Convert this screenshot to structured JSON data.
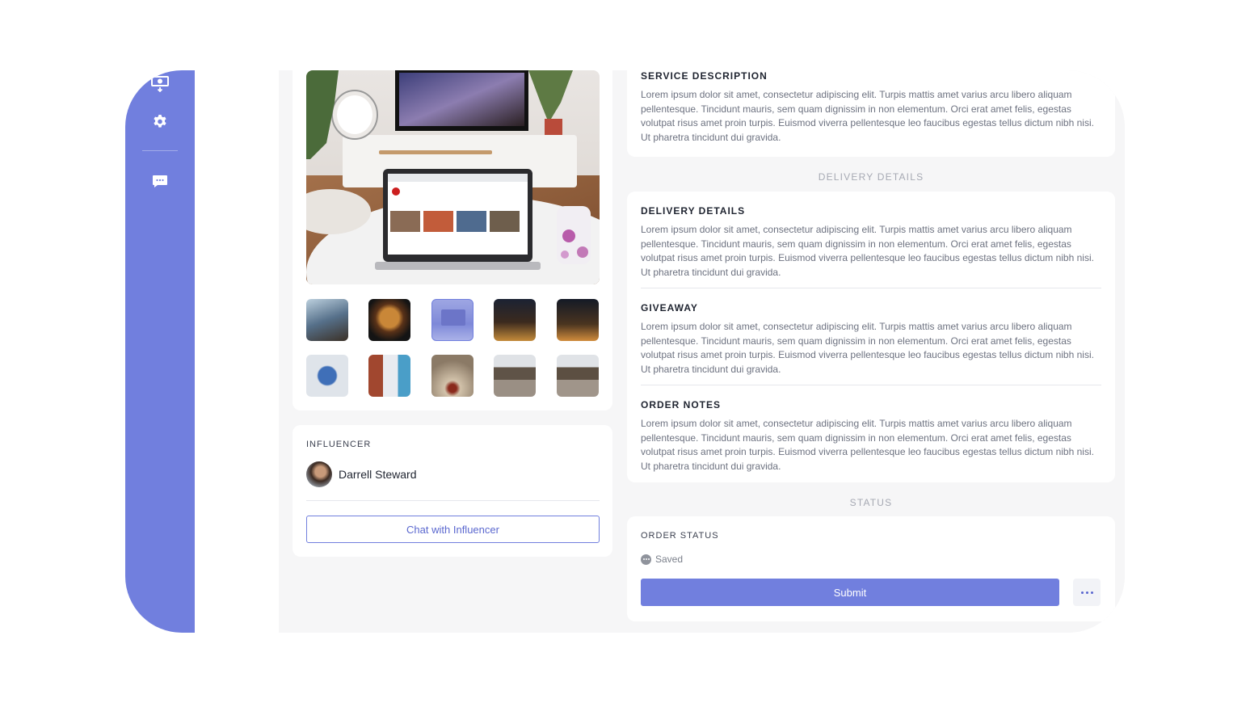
{
  "sidebar": {
    "icons": [
      "money-icon",
      "gear-icon",
      "chat-icon"
    ]
  },
  "influencer": {
    "label": "INFLUENCER",
    "name": "Darrell Steward",
    "chat_button": "Chat with Influencer"
  },
  "service": {
    "title": "SERVICE DESCRIPTION",
    "text": "Lorem ipsum dolor sit amet, consectetur adipiscing elit. Turpis mattis amet varius arcu libero aliquam pellentesque. Tincidunt mauris, sem quam dignissim in non elementum. Orci erat amet felis, egestas volutpat risus amet proin turpis. Euismod viverra pellentesque leo faucibus egestas tellus dictum nibh nisi. Ut pharetra tincidunt dui gravida."
  },
  "delivery_section_heading": "DELIVERY DETAILS",
  "details": [
    {
      "title": "DELIVERY DETAILS",
      "text": "Lorem ipsum dolor sit amet, consectetur adipiscing elit. Turpis mattis amet varius arcu libero aliquam pellentesque. Tincidunt mauris, sem quam dignissim in non elementum. Orci erat amet felis, egestas volutpat risus amet proin turpis. Euismod viverra pellentesque leo faucibus egestas tellus dictum nibh nisi. Ut pharetra tincidunt dui gravida."
    },
    {
      "title": "GIVEAWAY",
      "text": "Lorem ipsum dolor sit amet, consectetur adipiscing elit. Turpis mattis amet varius arcu libero aliquam pellentesque. Tincidunt mauris, sem quam dignissim in non elementum. Orci erat amet felis, egestas volutpat risus amet proin turpis. Euismod viverra pellentesque leo faucibus egestas tellus dictum nibh nisi. Ut pharetra tincidunt dui gravida."
    },
    {
      "title": "ORDER NOTES",
      "text": "Lorem ipsum dolor sit amet, consectetur adipiscing elit. Turpis mattis amet varius arcu libero aliquam pellentesque. Tincidunt mauris, sem quam dignissim in non elementum. Orci erat amet felis, egestas volutpat risus amet proin turpis. Euismod viverra pellentesque leo faucibus egestas tellus dictum nibh nisi. Ut pharetra tincidunt dui gravida."
    }
  ],
  "status_section_heading": "STATUS",
  "order_status": {
    "label": "ORDER STATUS",
    "value": "Saved",
    "submit": "Submit"
  },
  "colors": {
    "accent": "#717fde",
    "background": "#f6f6f7"
  }
}
